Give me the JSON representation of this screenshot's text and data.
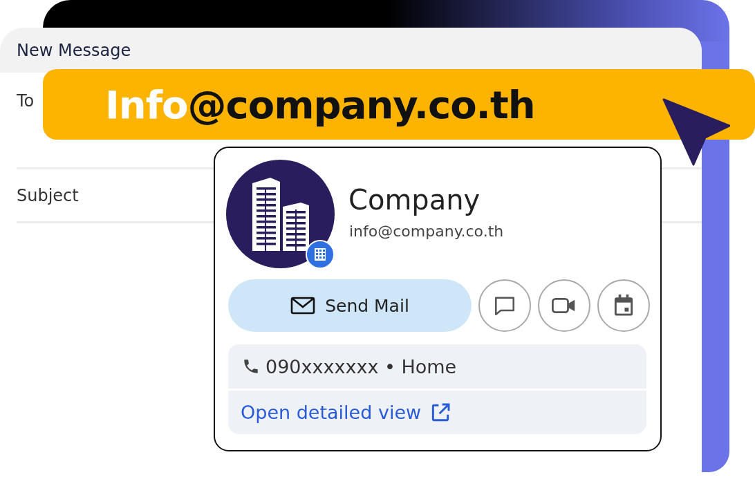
{
  "compose": {
    "title": "New Message",
    "fields": [
      {
        "label": "To"
      },
      {
        "label": "Subject"
      }
    ]
  },
  "banner": {
    "parts": [
      {
        "text": "Info",
        "color": "#ffffff"
      },
      {
        "text": "@company.co.th",
        "color": "#111111"
      }
    ]
  },
  "contact": {
    "name": "Company",
    "email": "info@company.co.th",
    "primary_action": "Send Mail",
    "actions": [
      {
        "kind": "chat"
      },
      {
        "kind": "video"
      },
      {
        "kind": "calendar"
      }
    ],
    "phone": "090xxxxxxx • Home",
    "link": "Open detailed view"
  }
}
